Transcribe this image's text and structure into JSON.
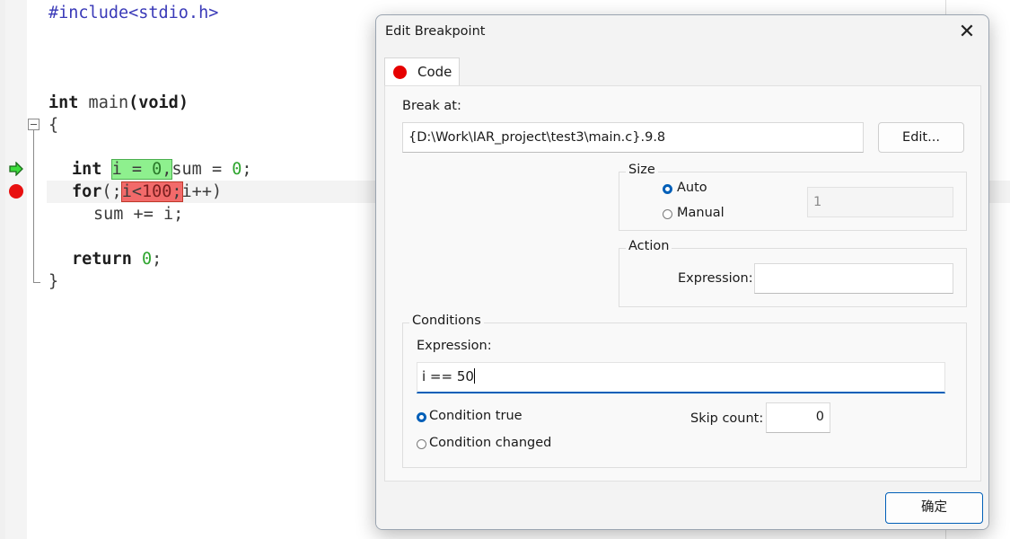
{
  "editor": {
    "line_include": "#include<stdio.h>",
    "main_kw": "int",
    "main_name": " main",
    "main_paren_open": "(",
    "main_void": "void",
    "main_paren_close": ")",
    "brace_open": "{",
    "decl_kw": "int",
    "decl_i": "i = ",
    "decl_zero": "0",
    "decl_comma": ",",
    "decl_sum": "sum = ",
    "decl_sum_zero": "0",
    "decl_semi": ";",
    "for_kw": "for",
    "for_open": "(;",
    "for_cond_i": "i<",
    "for_cond_num": "100",
    "for_cond_semi": ";",
    "for_rest": "i++)",
    "sum_line": "sum += i;",
    "return_kw": "return",
    "return_zero": "0",
    "return_semi": ";",
    "brace_close": "}"
  },
  "dialog": {
    "title": "Edit Breakpoint",
    "close_glyph": "✕",
    "tab_label": "Code",
    "break_at_label": "Break at:",
    "break_at_value": "{D:\\Work\\IAR_project\\test3\\main.c}.9.8",
    "edit_button": "Edit...",
    "size_title": "Size",
    "size_auto": "Auto",
    "size_manual": "Manual",
    "size_value": "1",
    "action_title": "Action",
    "action_expression_label": "Expression:",
    "action_expression_value": "",
    "conditions_title": "Conditions",
    "cond_expression_label": "Expression:",
    "cond_expression_value": "i == 50",
    "cond_true": "Condition true",
    "cond_changed": "Condition changed",
    "skip_count_label": "Skip count:",
    "skip_count_value": "0",
    "ok_button": "确定"
  },
  "colors": {
    "accent": "#005fb8",
    "breakpoint_red": "#e81010",
    "highlight_green": "#8ef08e",
    "highlight_red": "#f26a6a"
  }
}
